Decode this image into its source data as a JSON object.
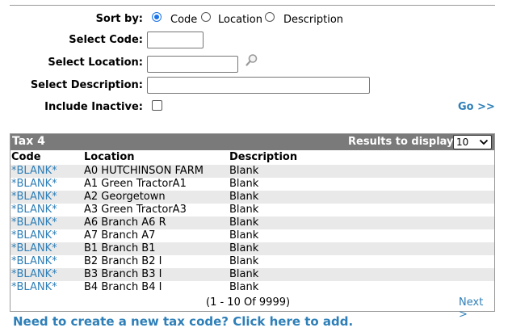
{
  "search": {
    "sort_by_label": "Sort by:",
    "sort_options": [
      {
        "label": "Code",
        "checked": true
      },
      {
        "label": "Location",
        "checked": false
      },
      {
        "label": "Description",
        "checked": false
      }
    ],
    "select_code_label": "Select Code:",
    "select_code_value": "",
    "select_location_label": "Select Location:",
    "select_location_value": "",
    "select_description_label": "Select Description:",
    "select_description_value": "",
    "include_inactive_label": "Include Inactive:",
    "include_inactive_checked": false,
    "go_label": "Go >>",
    "search_icon": "magnifier-icon"
  },
  "results": {
    "title": "Tax 4",
    "display_label": "Results to display:",
    "display_value": "10",
    "columns": [
      "Code",
      "Location",
      "Description"
    ],
    "rows": [
      {
        "code": "*BLANK*",
        "location": "A0 HUTCHINSON FARM",
        "description": "Blank"
      },
      {
        "code": "*BLANK*",
        "location": "A1 Green TractorA1",
        "description": "Blank"
      },
      {
        "code": "*BLANK*",
        "location": "A2 Georgetown",
        "description": "Blank"
      },
      {
        "code": "*BLANK*",
        "location": "A3 Green TractorA3",
        "description": "Blank"
      },
      {
        "code": "*BLANK*",
        "location": "A6 Branch A6 R",
        "description": "Blank"
      },
      {
        "code": "*BLANK*",
        "location": "A7 Branch A7",
        "description": "Blank"
      },
      {
        "code": "*BLANK*",
        "location": "B1 Branch B1",
        "description": "Blank"
      },
      {
        "code": "*BLANK*",
        "location": "B2 Branch B2 I",
        "description": "Blank"
      },
      {
        "code": "*BLANK*",
        "location": "B3 Branch B3 I",
        "description": "Blank"
      },
      {
        "code": "*BLANK*",
        "location": "B4 Branch B4 I",
        "description": "Blank"
      }
    ],
    "pager_text": "(1 - 10 Of 9999)",
    "next_label": "Next >"
  },
  "create_link_label": "Need to create a new tax code? Click here to add.",
  "colors": {
    "link": "#2e7fb8",
    "header_bar": "#7a7a7a",
    "row_alt": "#e9e9e9",
    "radio_accent": "#1a73e8"
  }
}
